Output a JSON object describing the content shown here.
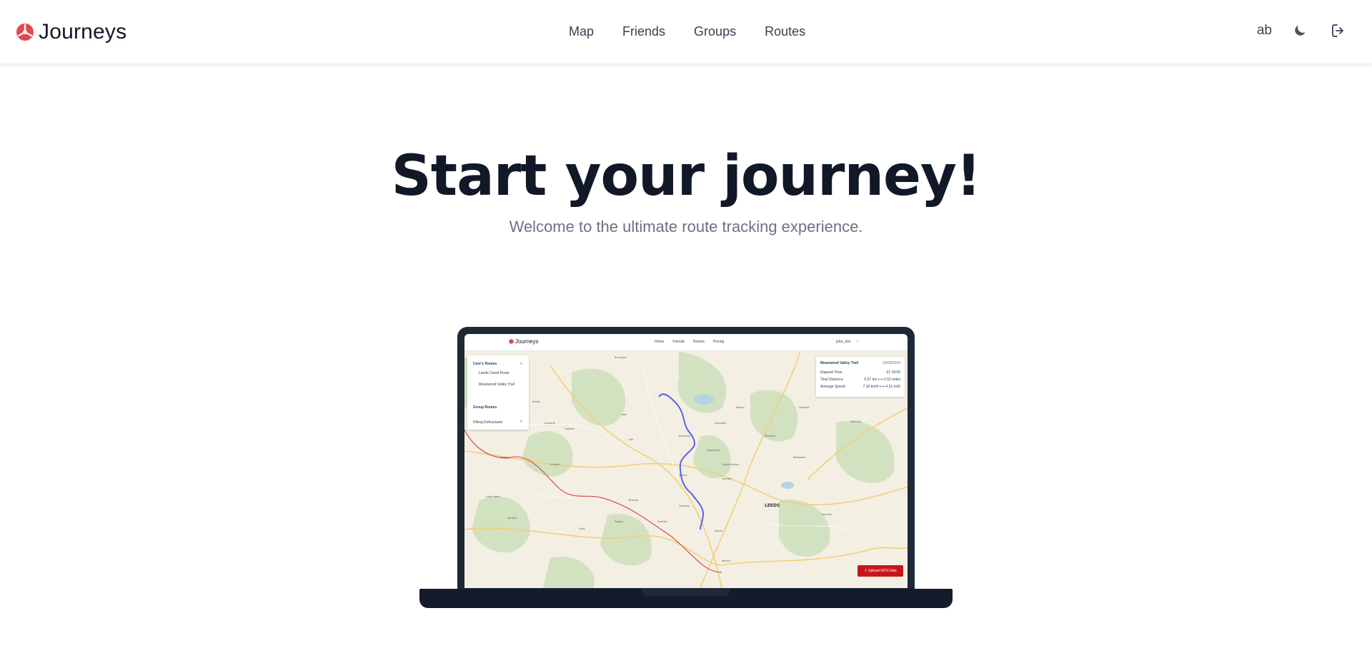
{
  "header": {
    "brand": "Journeys",
    "nav": [
      "Map",
      "Friends",
      "Groups",
      "Routes"
    ],
    "user_initials": "ab",
    "icons": {
      "logo": "journeys-logo-icon",
      "theme": "moon-icon",
      "logout": "logout-icon"
    }
  },
  "hero": {
    "title": "Start your journey!",
    "subtitle": "Welcome to the ultimate route tracking experience."
  },
  "preview": {
    "brand": "Journeys",
    "nav": [
      "Home",
      "Friends",
      "Routes",
      "Pricing"
    ],
    "user": "john_doe",
    "users_routes_title": "User's Routes",
    "users_routes": [
      "Leeds Canal Route",
      "Meanwood Valley Trail"
    ],
    "group_routes_title": "Group Routes",
    "group_select": "Hiking Enthusiasts",
    "stats": {
      "route_name": "Meanwood Valley Trail",
      "date": "19/05/2024",
      "elapsed_label": "Elapsed Time:",
      "elapsed_value": "01:18:00",
      "distance_label": "Total Distance:",
      "distance_value": "9.07 km ⟷ 5.63 miles",
      "speed_label": "Average Speed:",
      "speed_value": "7.16 km/h ⟷ 4.51 mi/h"
    },
    "upload_label": "Upload GPS Data",
    "map_places": [
      "Bramhope",
      "Yeadon",
      "Horsforth",
      "Adel",
      "Alwoodley",
      "Shadwell",
      "Wetherby",
      "Headingley",
      "Chapel Allerton",
      "Roundhay",
      "Seacroft",
      "Kirkstall",
      "Bramley",
      "Pudsey",
      "Calverley",
      "Armley",
      "Wortley",
      "LEEDS",
      "Harehills",
      "Cross Gates",
      "Garforth",
      "Otley",
      "Guiseley",
      "Rawdon",
      "Thackley",
      "Idle",
      "Shipley",
      "Baildon",
      "Moortown",
      "Weetwood"
    ],
    "colors": {
      "primary_route": "#5863e8",
      "secondary_route": "#e0484a",
      "upload": "#c8151b"
    }
  }
}
